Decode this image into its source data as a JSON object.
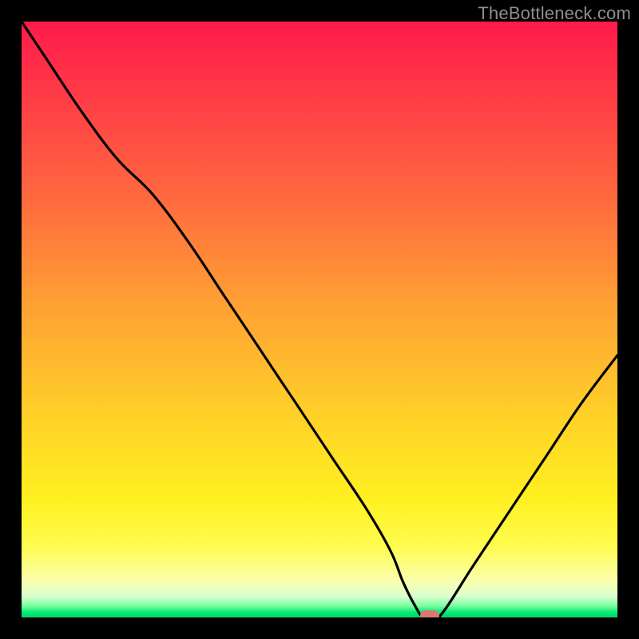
{
  "watermark": "TheBottleneck.com",
  "colors": {
    "frame": "#000000",
    "curve": "#000000",
    "marker": "#d87876",
    "gradient_top": "#ff1a4b",
    "gradient_bottom": "#00d566"
  },
  "chart_data": {
    "type": "line",
    "title": "",
    "xlabel": "",
    "ylabel": "",
    "xlim": [
      0,
      100
    ],
    "ylim": [
      0,
      100
    ],
    "x": [
      0,
      4,
      10,
      16,
      22,
      28,
      34,
      40,
      46,
      52,
      58,
      62,
      64,
      66,
      67.5,
      70,
      76,
      82,
      88,
      94,
      100
    ],
    "values": [
      100,
      94,
      85,
      77,
      71,
      63,
      54,
      45,
      36,
      27,
      18,
      11,
      6,
      2,
      0,
      0,
      9,
      18,
      27,
      36,
      44
    ],
    "marker": {
      "x": 68.5,
      "y": 0
    },
    "grid": false,
    "legend": false
  }
}
